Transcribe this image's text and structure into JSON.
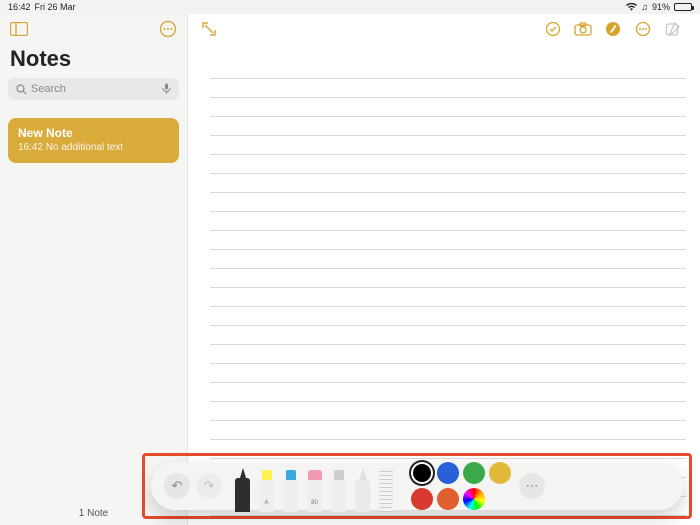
{
  "status": {
    "time": "16:42",
    "date": "Fri 26 Mar",
    "battery_pct": "91%"
  },
  "sidebar": {
    "title": "Notes",
    "search_placeholder": "Search",
    "note": {
      "title": "New Note",
      "subtitle": "16:42  No additional text"
    },
    "footer": "1 Note"
  },
  "palette": {
    "tools": [
      "pen",
      "marker",
      "pencil-tip",
      "eraser",
      "lasso",
      "pencil",
      "ruler"
    ],
    "colors": [
      "#000000",
      "#2860d8",
      "#3aa94a",
      "#e2b93b",
      "#d83a32",
      "#e06030",
      "rainbow"
    ],
    "selected_color_index": 0
  }
}
